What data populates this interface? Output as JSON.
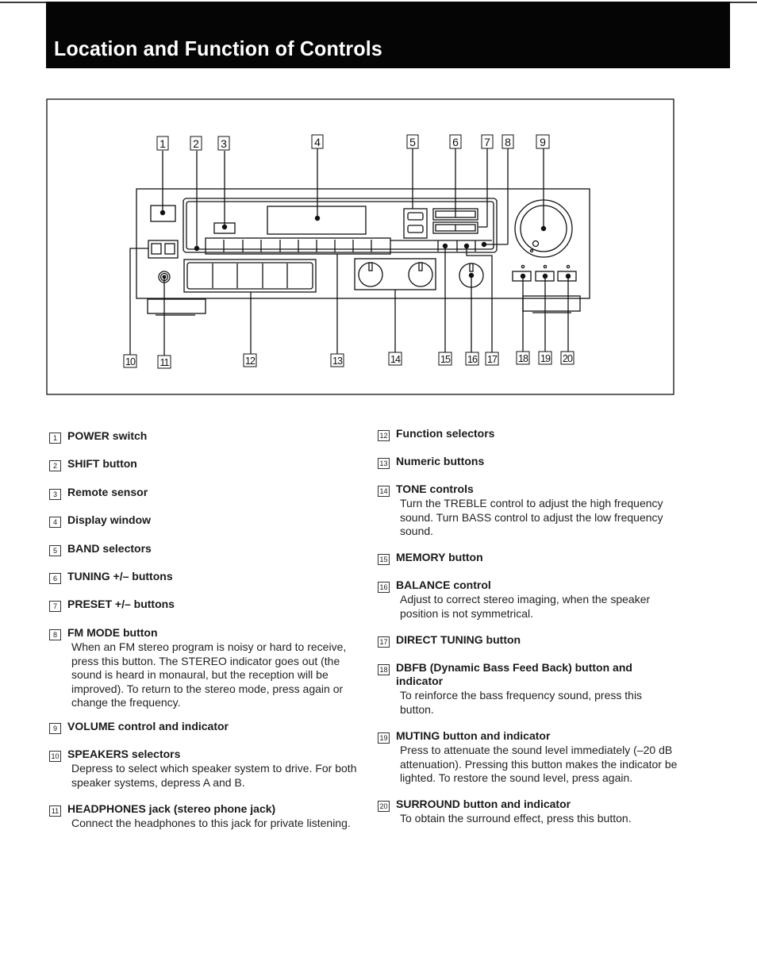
{
  "page": {
    "title": "Location and Function of Controls"
  },
  "diagram": {
    "callouts_top": [
      "1",
      "2",
      "3",
      "4",
      "5",
      "6",
      "7",
      "8",
      "9"
    ],
    "callouts_bottom": [
      "10",
      "11",
      "12",
      "13",
      "14",
      "15",
      "16",
      "17",
      "18",
      "19",
      "20"
    ]
  },
  "items": [
    {
      "num": "1",
      "title": "POWER switch",
      "desc": ""
    },
    {
      "num": "2",
      "title": "SHIFT button",
      "desc": ""
    },
    {
      "num": "3",
      "title": "Remote sensor",
      "desc": ""
    },
    {
      "num": "4",
      "title": "Display window",
      "desc": ""
    },
    {
      "num": "5",
      "title": "BAND selectors",
      "desc": ""
    },
    {
      "num": "6",
      "title": "TUNING +/– buttons",
      "desc": ""
    },
    {
      "num": "7",
      "title": "PRESET +/– buttons",
      "desc": ""
    },
    {
      "num": "8",
      "title": "FM MODE button",
      "desc": "When an FM stereo program is noisy or hard to receive, press this button. The STEREO indicator goes out (the sound is heard in monaural, but the reception will be improved). To return to the stereo mode, press again or change the frequency."
    },
    {
      "num": "9",
      "title": "VOLUME control and indicator",
      "desc": ""
    },
    {
      "num": "10",
      "title": "SPEAKERS selectors",
      "desc": "Depress to select which speaker system to drive. For both speaker systems, depress A and B."
    },
    {
      "num": "11",
      "title": "HEADPHONES jack (stereo phone jack)",
      "desc": "Connect the headphones to this jack for private listening."
    },
    {
      "num": "12",
      "title": "Function selectors",
      "desc": ""
    },
    {
      "num": "13",
      "title": "Numeric buttons",
      "desc": ""
    },
    {
      "num": "14",
      "title": "TONE controls",
      "desc": "Turn the TREBLE control to adjust the high frequency sound. Turn BASS control to adjust the low frequency sound."
    },
    {
      "num": "15",
      "title": "MEMORY button",
      "desc": ""
    },
    {
      "num": "16",
      "title": "BALANCE control",
      "desc": "Adjust to correct stereo imaging, when the speaker position is not symmetrical."
    },
    {
      "num": "17",
      "title": "DIRECT TUNING button",
      "desc": ""
    },
    {
      "num": "18",
      "title": "DBFB (Dynamic Bass Feed Back) button and indicator",
      "desc": "To reinforce the bass frequency sound, press this button."
    },
    {
      "num": "19",
      "title": "MUTING button and indicator",
      "desc": "Press to attenuate the sound level immediately (–20 dB attenuation). Pressing this button makes the indicator be lighted. To restore the sound level, press again."
    },
    {
      "num": "20",
      "title": "SURROUND button and indicator",
      "desc": "To obtain the surround effect, press this button."
    }
  ]
}
